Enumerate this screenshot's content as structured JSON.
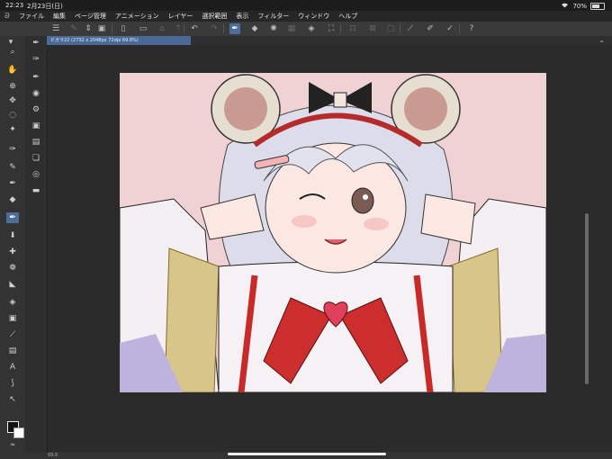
{
  "status": {
    "time": "22:23",
    "date": "2月23日(日)",
    "wifi_icon": "wifi-icon",
    "battery": "70%"
  },
  "menu": {
    "items": [
      "ファイル",
      "編集",
      "ページ管理",
      "アニメーション",
      "レイヤー",
      "選択範囲",
      "表示",
      "フィルター",
      "ウィンドウ",
      "ヘルプ"
    ]
  },
  "tab": {
    "label": "ビガラ22 (2732 x 2048px 72dpi 69.8%)"
  },
  "bottom": {
    "zoom": "69.8"
  },
  "colors": {
    "accent": "#4d6d9a",
    "canvas_bg": "#f1d2d4"
  }
}
